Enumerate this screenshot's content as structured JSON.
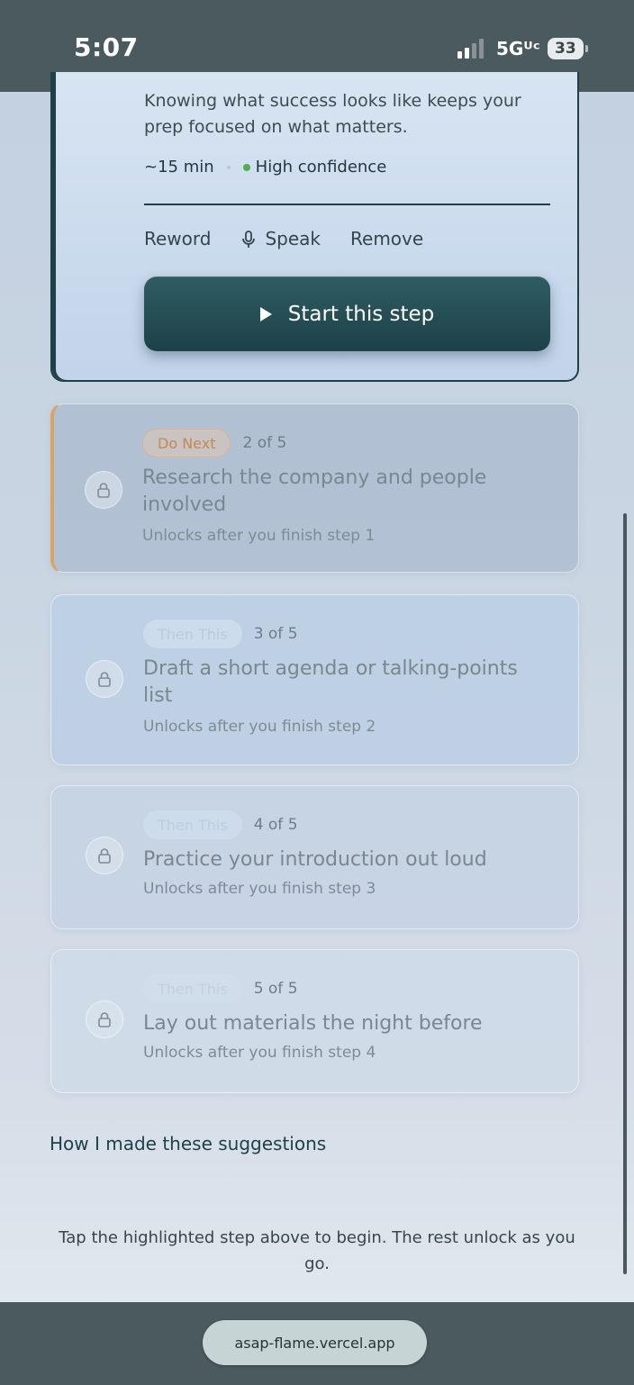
{
  "status_bar": {
    "time": "5:07",
    "network": "5Gᵁᶜ",
    "battery": "33"
  },
  "active_step": {
    "description": "Knowing what success looks like keeps your prep focused on what matters.",
    "duration": "~15 min",
    "confidence": "High confidence",
    "actions": {
      "reword": "Reword",
      "speak": "Speak",
      "remove": "Remove"
    },
    "start_label": "Start this step"
  },
  "steps": [
    {
      "badge": "Do Next",
      "position": "2 of 5",
      "title": "Research the company and people involved",
      "subtitle": "Unlocks after you finish step 1"
    },
    {
      "badge": "Then This",
      "position": "3 of 5",
      "title": "Draft a short agenda or talking-points list",
      "subtitle": "Unlocks after you finish step 2"
    },
    {
      "badge": "Then This",
      "position": "4 of 5",
      "title": "Practice your introduction out loud",
      "subtitle": "Unlocks after you finish step 3"
    },
    {
      "badge": "Then This",
      "position": "5 of 5",
      "title": "Lay out materials the night before",
      "subtitle": "Unlocks after you finish step 4"
    }
  ],
  "suggestions_link": "How I made these suggestions",
  "footer_note": "Tap the highlighted step above to begin. The rest unlock as you go.",
  "browser": {
    "url": "asap-flame.vercel.app"
  },
  "colors": {
    "accent_dark_teal": "#1f4047",
    "do_next_orange": "#d8a46a",
    "confidence_green": "#4caf50"
  },
  "icons": [
    "signal-icon",
    "battery-icon",
    "mic-icon",
    "play-icon",
    "lock-icon"
  ]
}
